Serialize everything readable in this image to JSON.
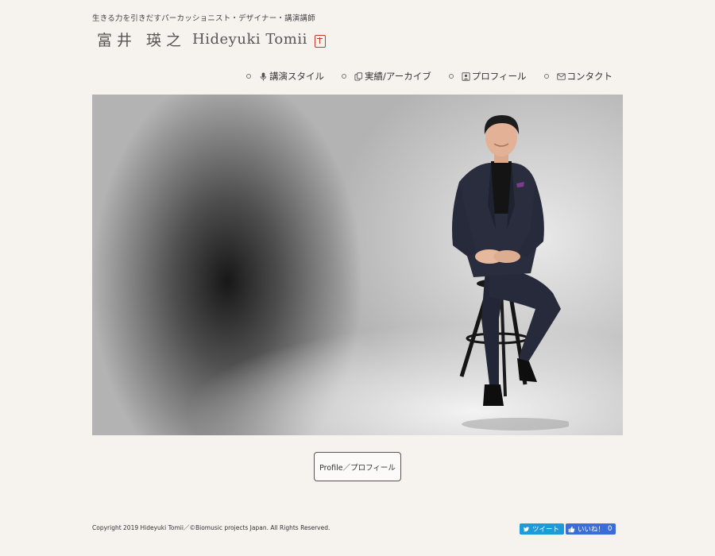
{
  "header": {
    "tagline": "生きる力を引きだすパーカッショニスト・デザイナー・講演講師",
    "logo_jp": "富井 瑛之",
    "logo_en": "Hideyuki Tomii"
  },
  "nav": {
    "items": [
      {
        "label": "講演スタイル",
        "icon": "microphone-icon"
      },
      {
        "label": "実績/アーカイブ",
        "icon": "copy-icon"
      },
      {
        "label": "プロフィール",
        "icon": "profile-card-icon"
      },
      {
        "label": "コンタクト",
        "icon": "envelope-icon"
      }
    ]
  },
  "hero": {
    "image_description": "man-in-dark-suit-sitting-on-stool"
  },
  "main": {
    "profile_button": "Profile／プロフィール"
  },
  "footer": {
    "copyright": "Copyright 2019 Hideyuki Tomii／©Biomusic projects Japan. All Rights Reserved.",
    "tweet_label": "ツイート",
    "like_label": "いいね！",
    "like_count": "0"
  },
  "colors": {
    "background": "#f6f3ef",
    "seal": "#c8372d",
    "twitter": "#1d9bd8",
    "facebook": "#3b6dd8"
  }
}
